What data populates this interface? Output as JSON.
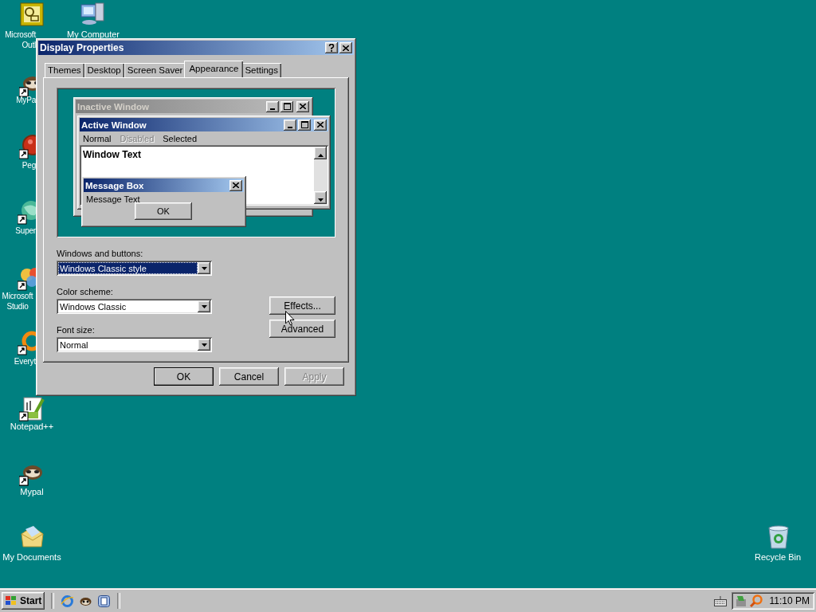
{
  "desktop_icons": [
    {
      "label": "Microsoft Outl"
    },
    {
      "label": "My Computer"
    },
    {
      "label": "MyPa"
    },
    {
      "label": "Peg"
    },
    {
      "label": "Super"
    },
    {
      "label": "Microsoft Studio"
    },
    {
      "label": "Everyt"
    },
    {
      "label": "Notepad++"
    },
    {
      "label": "Mypal"
    },
    {
      "label": "My Documents"
    },
    {
      "label": "Recycle Bin"
    }
  ],
  "window": {
    "title": "Display Properties",
    "tabs": [
      {
        "label": "Themes",
        "selected": false
      },
      {
        "label": "Desktop",
        "selected": false
      },
      {
        "label": "Screen Saver",
        "selected": false
      },
      {
        "label": "Appearance",
        "selected": true
      },
      {
        "label": "Settings",
        "selected": false
      }
    ],
    "preview": {
      "inactive_title": "Inactive Window",
      "active_title": "Active Window",
      "menu": [
        {
          "label": "Normal",
          "disabled": false
        },
        {
          "label": "Disabled",
          "disabled": true
        },
        {
          "label": "Selected",
          "disabled": false
        }
      ],
      "window_text": "Window Text",
      "message_box": {
        "title": "Message Box",
        "text": "Message Text",
        "button": "OK"
      }
    },
    "fields": [
      {
        "label": "Windows and buttons:",
        "value": "Windows Classic style",
        "focused": true
      },
      {
        "label": "Color scheme:",
        "value": "Windows Classic",
        "focused": false
      },
      {
        "label": "Font size:",
        "value": "Normal",
        "focused": false
      }
    ],
    "side_buttons": [
      {
        "label": "Effects..."
      },
      {
        "label": "Advanced"
      }
    ],
    "buttons": [
      {
        "label": "OK",
        "default": true,
        "disabled": false
      },
      {
        "label": "Cancel",
        "default": false,
        "disabled": false
      },
      {
        "label": "Apply",
        "default": false,
        "disabled": true
      }
    ]
  },
  "taskbar": {
    "start": "Start",
    "clock": "11:10 PM"
  }
}
